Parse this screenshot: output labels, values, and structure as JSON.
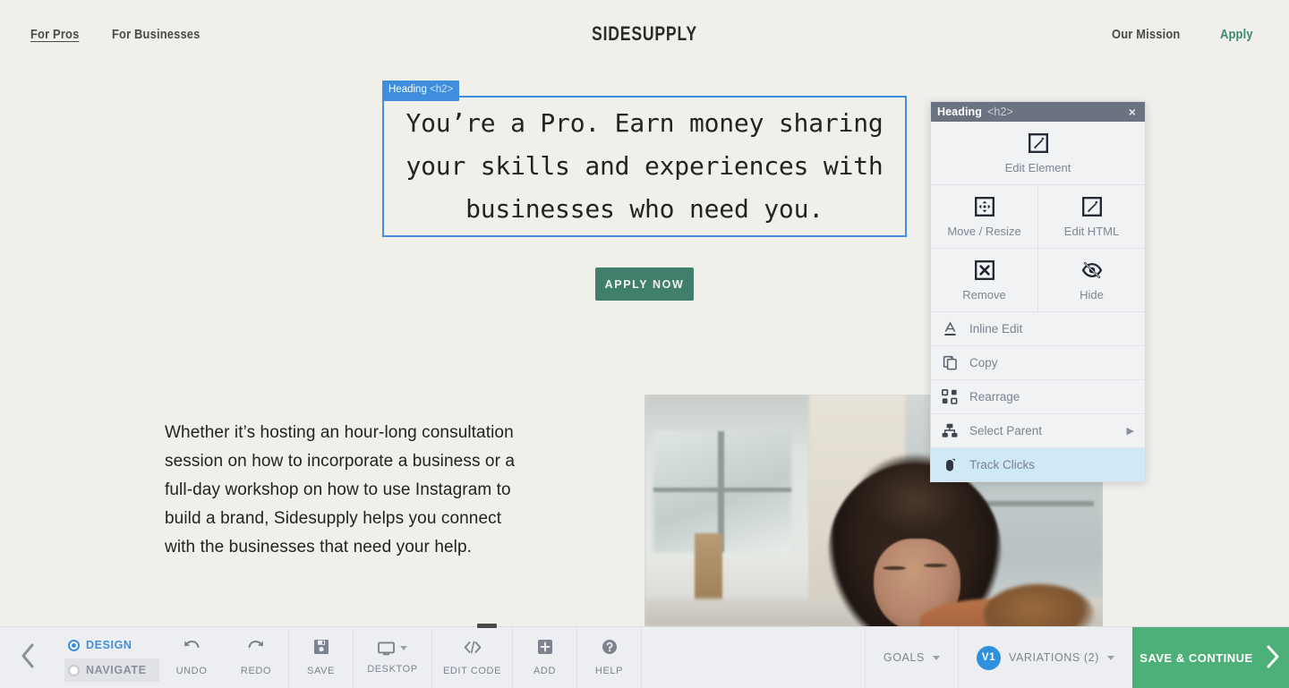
{
  "site": {
    "brand": "SIDESUPPLY",
    "nav_left": [
      {
        "label": "For Pros",
        "underlined": true
      },
      {
        "label": "For Businesses",
        "underlined": false
      }
    ],
    "nav_right": [
      {
        "label": "Our Mission",
        "accent": false
      },
      {
        "label": "Apply",
        "accent": true
      }
    ],
    "hero_heading": "You’re a Pro. Earn money sharing your skills and experiences with businesses who need you.",
    "cta_label": "APPLY NOW",
    "body_paragraph": "Whether it’s hosting an hour-long consultation session on how to incorporate a business or a full-day workshop on how to use Instagram to build a brand, Sidesupply helps you connect with the businesses that need your help.",
    "colors": {
      "background": "#f1efe9",
      "cta": "#3f7f6b",
      "accent_link": "#3d8a6b"
    }
  },
  "selection": {
    "badge_name": "Heading",
    "badge_tag": "<h2>",
    "outline_color": "#3e8edd"
  },
  "context_menu": {
    "title": "Heading",
    "title_tag": "<h2>",
    "close_label": "×",
    "tiles": [
      [
        {
          "label": "Edit Element",
          "icon": "pencil-square-icon"
        }
      ],
      [
        {
          "label": "Move / Resize",
          "icon": "move-resize-icon"
        },
        {
          "label": "Edit HTML",
          "icon": "pencil-square-icon"
        }
      ],
      [
        {
          "label": "Remove",
          "icon": "x-square-icon"
        },
        {
          "label": "Hide",
          "icon": "eye-slash-icon"
        }
      ]
    ],
    "items": [
      {
        "label": "Inline Edit",
        "icon": "text-underline-icon",
        "submenu": false,
        "highlight": false
      },
      {
        "label": "Copy",
        "icon": "copy-icon",
        "submenu": false,
        "highlight": false
      },
      {
        "label": "Rearrage",
        "icon": "rearrange-icon",
        "submenu": false,
        "highlight": false
      },
      {
        "label": "Select Parent",
        "icon": "hierarchy-icon",
        "submenu": true,
        "highlight": false
      },
      {
        "label": "Track Clicks",
        "icon": "mouse-icon",
        "submenu": false,
        "highlight": true
      }
    ],
    "highlight_color": "#cfe9f7",
    "header_color": "#6b7280"
  },
  "toolbar": {
    "back_icon": "chevron-left-icon",
    "modes": [
      {
        "label": "DESIGN",
        "selected": true
      },
      {
        "label": "NAVIGATE",
        "selected": false
      }
    ],
    "tools": [
      {
        "label": "UNDO",
        "icon": "undo-arrow-icon"
      },
      {
        "label": "REDO",
        "icon": "redo-arrow-icon"
      },
      {
        "label": "SAVE",
        "icon": "save-disk-icon"
      },
      {
        "label": "DESKTOP",
        "icon": "monitor-icon"
      },
      {
        "label": "EDIT CODE",
        "icon": "code-brackets-icon"
      },
      {
        "label": "ADD",
        "icon": "plus-square-icon"
      },
      {
        "label": "HELP",
        "icon": "question-circle-icon"
      }
    ],
    "goals_label": "GOALS",
    "variation_badge": "V1",
    "variations_label": "VARIATIONS (2)",
    "save_continue_label": "SAVE & CONTINUE",
    "save_continue_color": "#4cb078"
  }
}
